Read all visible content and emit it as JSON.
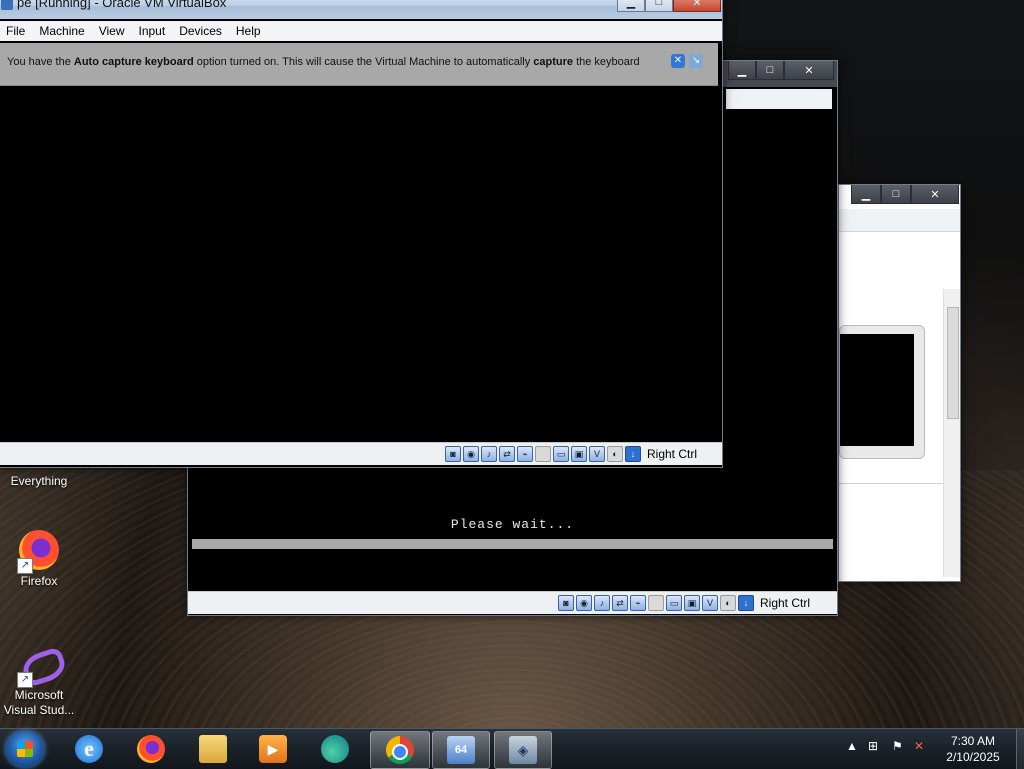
{
  "desktop": {
    "icons": [
      {
        "label": "Everything"
      },
      {
        "label": "Firefox"
      },
      {
        "label": "Microsoft Visual Stud..."
      }
    ]
  },
  "front_window": {
    "title": "pe [Running] - Oracle VM VirtualBox",
    "menu": [
      "File",
      "Machine",
      "View",
      "Input",
      "Devices",
      "Help"
    ],
    "notice": {
      "prefix": "You have the ",
      "bold1": "Auto capture keyboard",
      "middle": " option turned on. This will cause the Virtual Machine to automatically ",
      "bold2": "capture",
      "suffix": " the keyboard"
    },
    "host_key": "Right Ctrl"
  },
  "middle_window": {
    "screen_text": "Please wait...",
    "host_key": "Right Ctrl"
  },
  "back_window": {},
  "taskbar": {
    "items": [
      "ie-icon",
      "firefox-icon",
      "explorer-icon",
      "media-player-icon",
      "edge-icon",
      "chrome-icon",
      "virtualbox-manager-icon",
      "virtualbox-icon"
    ],
    "clock_time": "7:30 AM",
    "clock_date": "2/10/2025"
  }
}
